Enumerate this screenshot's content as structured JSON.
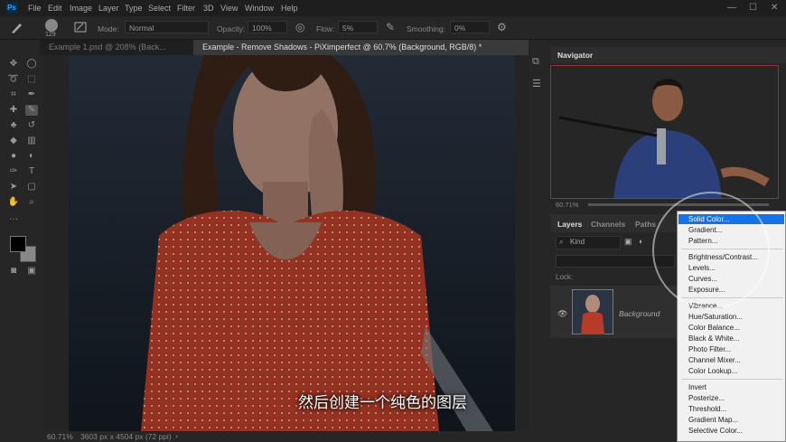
{
  "menubar": {
    "logo": "Ps",
    "items": [
      "File",
      "Edit",
      "Image",
      "Layer",
      "Type",
      "Select",
      "Filter",
      "3D",
      "View",
      "Window",
      "Help"
    ]
  },
  "options": {
    "brush_size": "129",
    "mode_label": "Mode:",
    "mode_value": "Normal",
    "opacity_label": "Opacity:",
    "opacity_value": "100%",
    "flow_label": "Flow:",
    "flow_value": "5%",
    "smoothing_label": "Smoothing:",
    "smoothing_value": "0%"
  },
  "tabs": [
    {
      "label": "Example 1.psd @ 208% (Back..."
    },
    {
      "label": "Example - Remove Shadows - PiXimperfect @ 60.7% (Background, RGB/8) *"
    }
  ],
  "status": {
    "zoom": "60.71%",
    "doc_info": "3603 px x 4504 px (72 ppi)"
  },
  "subtitle": "然后创建一个纯色的图层",
  "navigator": {
    "title": "Navigator",
    "zoom": "60.71%"
  },
  "layers_panel": {
    "tabs": [
      "Layers",
      "Channels",
      "Paths"
    ],
    "kind_label": "Kind",
    "layer_name": "Background",
    "lock_label": "Lock:"
  },
  "adjustment_menu": {
    "group1": [
      "Solid Color...",
      "Gradient...",
      "Pattern..."
    ],
    "group2": [
      "Brightness/Contrast...",
      "Levels...",
      "Curves...",
      "Exposure..."
    ],
    "group3": [
      "Vibrance...",
      "Hue/Saturation...",
      "Color Balance...",
      "Black & White...",
      "Photo Filter...",
      "Channel Mixer...",
      "Color Lookup..."
    ],
    "group4": [
      "Invert",
      "Posterize...",
      "Threshold...",
      "Gradient Map...",
      "Selective Color..."
    ]
  },
  "colors": {
    "menu_highlight": "#1473e6",
    "dress": "#c0402c",
    "ui_bg": "#262626"
  }
}
